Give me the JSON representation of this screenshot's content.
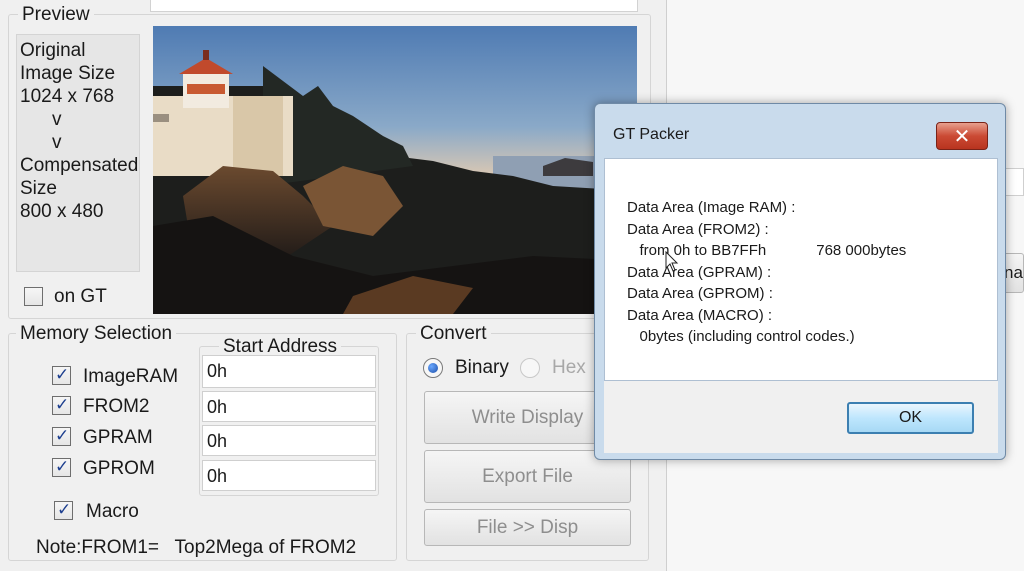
{
  "preview": {
    "title": "Preview",
    "info_lines": [
      "Original",
      "Image Size",
      "1024 x 768",
      "v",
      "v",
      "Compensated",
      "Size",
      "800 x 480"
    ],
    "on_gt_label": "on GT",
    "on_gt_checked": false
  },
  "memory": {
    "title": "Memory Selection",
    "start_address_label": "Start Address",
    "items": [
      {
        "label": "ImageRAM",
        "checked": true,
        "address": "0h"
      },
      {
        "label": "FROM2",
        "checked": true,
        "address": "0h"
      },
      {
        "label": "GPRAM",
        "checked": true,
        "address": "0h"
      },
      {
        "label": "GPROM",
        "checked": true,
        "address": "0h"
      }
    ],
    "macro_label": "Macro",
    "macro_checked": true,
    "note": "Note:FROM1=   Top2Mega of FROM2"
  },
  "convert": {
    "title": "Convert",
    "binary_label": "Binary",
    "hex_label": "Hex",
    "selected": "Binary",
    "write_display_label": "Write Display",
    "export_file_label": "Export File",
    "file_disp_label": "File >> Disp"
  },
  "dialog": {
    "title": "GT Packer",
    "close_symbol": "✕",
    "lines": [
      "Data Area (Image RAM) :",
      "Data Area (FROM2) :",
      "   from 0h to BB7FFh            768 000bytes",
      "Data Area (GPRAM) :",
      "Data Area (GPROM) :",
      "Data Area (MACRO) :",
      "   0bytes (including control codes.)"
    ],
    "ok_label": "OK"
  },
  "right_edge": {
    "partial_label": "na"
  },
  "colors": {
    "window_bg": "#f0f0f0",
    "dialog_frame": "#c9dbec",
    "close_red": "#cb4a34",
    "ok_border": "#3c7fb1"
  }
}
